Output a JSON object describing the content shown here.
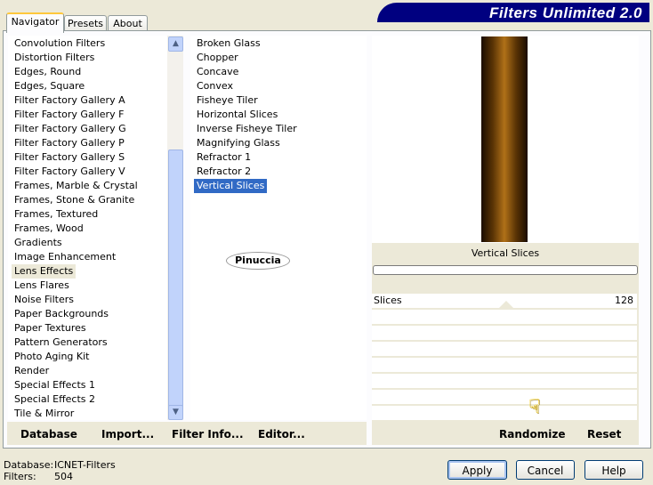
{
  "title": "Filters Unlimited 2.0",
  "tabs": [
    {
      "label": "Navigator",
      "active": true
    },
    {
      "label": "Presets"
    },
    {
      "label": "About"
    }
  ],
  "categories": [
    "Convolution Filters",
    "Distortion Filters",
    "Edges, Round",
    "Edges, Square",
    "Filter Factory Gallery A",
    "Filter Factory Gallery F",
    "Filter Factory Gallery G",
    "Filter Factory Gallery P",
    "Filter Factory Gallery S",
    "Filter Factory Gallery V",
    "Frames, Marble & Crystal",
    "Frames, Stone & Granite",
    "Frames, Textured",
    "Frames, Wood",
    "Gradients",
    "Image Enhancement",
    "Lens Effects",
    "Lens Flares",
    "Noise Filters",
    "Paper Backgrounds",
    "Paper Textures",
    "Pattern Generators",
    "Photo Aging Kit",
    "Render",
    "Special Effects 1",
    "Special Effects 2",
    "Tile & Mirror"
  ],
  "selected_category": "Lens Effects",
  "filters": [
    "Broken Glass",
    "Chopper",
    "Concave",
    "Convex",
    "Fisheye Tiler",
    "Horizontal Slices",
    "Inverse Fisheye Tiler",
    "Magnifying Glass",
    "Refractor 1",
    "Refractor 2",
    "Vertical Slices"
  ],
  "selected_filter": "Vertical Slices",
  "watermark": "Pinuccia",
  "preview": {
    "filter_name": "Vertical Slices"
  },
  "params": [
    {
      "label": "Slices",
      "value": "128"
    }
  ],
  "left_buttons": {
    "database": "Database",
    "import": "Import...",
    "filter_info": "Filter Info...",
    "editor": "Editor..."
  },
  "right_buttons": {
    "randomize": "Randomize",
    "reset": "Reset"
  },
  "status": {
    "database_label": "Database:",
    "database_value": "ICNET-Filters",
    "filters_label": "Filters:",
    "filters_value": "504"
  },
  "dialog_buttons": {
    "apply": "Apply",
    "cancel": "Cancel",
    "help": "Help"
  }
}
